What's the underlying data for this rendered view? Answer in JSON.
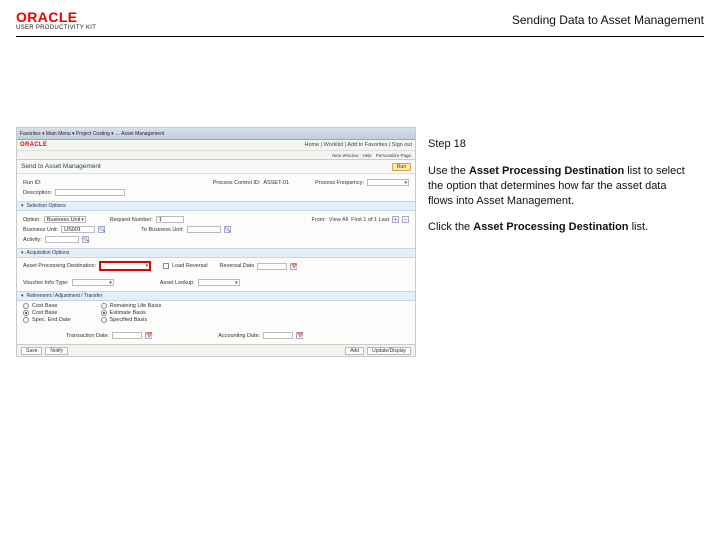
{
  "header": {
    "logo_text": "ORACLE",
    "logo_sub": "USER PRODUCTIVITY KIT",
    "title": "Sending Data to Asset Management"
  },
  "guide": {
    "step_label": "Step 18",
    "para1_a": "Use the ",
    "para1_b": "Asset Processing Destination",
    "para1_c": " list to select the option that determines how far the asset data flows into Asset Management.",
    "para2_a": "Click the ",
    "para2_b": "Asset Processing Destination",
    "para2_c": " list."
  },
  "app": {
    "topbar": {
      "menu": "Favorites ▾   Main Menu ▾   Project Costing ▾   …   Asset Management"
    },
    "brand": {
      "oracle": "ORACLE",
      "links": "Home | Worklist | Add to Favorites | Sign out"
    },
    "subbar": {
      "a": "New Window",
      "b": "Help",
      "c": "Personalize Page"
    },
    "title": "Send to Asset Management",
    "run_btn": "Run",
    "id_row": {
      "runid_lbl": "Run ID:",
      "runid_val": "",
      "pcid_lbl": "Process Control ID:",
      "pcid_val": "ASSET-01",
      "pf_lbl": "Process Frequency:"
    },
    "desc_row": {
      "lbl": "Description:",
      "val": ""
    },
    "sel_hdr": "Selection Options",
    "sel": {
      "opt_lbl": "Option:",
      "opt_val": "Business Unit",
      "proj_lbl": "Request Number:",
      "proj_val": "1",
      "from_lbl": "From:",
      "from_val": "",
      "view_lbl": "View All",
      "nav": "First  1 of 1  Last",
      "bu_lbl": "Business Unit:",
      "bu_val": "US001",
      "tobu_lbl": "To Business Unit:",
      "act_lbl": "Activity:"
    },
    "acct_hdr": "Acquisition Options",
    "asset": {
      "lbl": "Asset Processing Destination:",
      "value": "",
      "rev_lbl": "Reversal Date",
      "rev_name": "Load Reversal",
      "vt_lbl": "Voucher Info Type:",
      "vt_val": "",
      "al_lbl": "Asset Lookup:"
    },
    "ret_hdr": "Retirement / Adjustment / Transfer",
    "ret": {
      "c1a": "Cost Base",
      "c1b": "Cost Base",
      "c1c": "Spec. End Date",
      "c2a": "Remaining Life Basis",
      "c2b": "Estimate Basis",
      "c2c": "Specified Basis",
      "txn_lbl": "Transaction Date:",
      "acct_lbl": "Accounting Date:"
    },
    "footer": {
      "save": "Save",
      "notify": "Notify",
      "add": "Add",
      "update": "Update/Display"
    }
  }
}
